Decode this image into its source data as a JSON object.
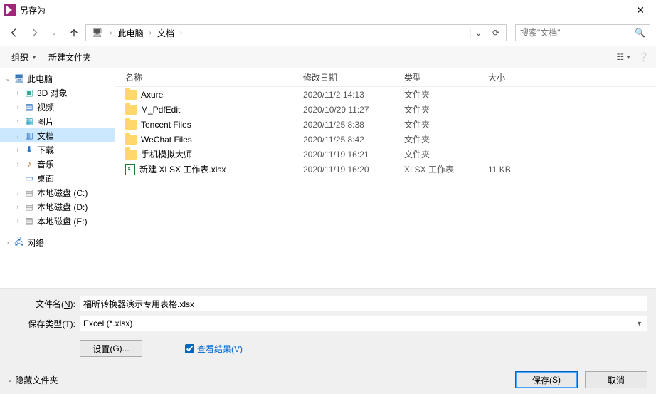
{
  "window": {
    "title": "另存为"
  },
  "breadcrumb": {
    "root": "此电脑",
    "folder": "文档"
  },
  "search": {
    "placeholder": "搜索\"文档\""
  },
  "toolbar": {
    "organize": "组织",
    "new_folder": "新建文件夹"
  },
  "columns": {
    "name": "名称",
    "date": "修改日期",
    "type": "类型",
    "size": "大小"
  },
  "tree": {
    "this_pc": "此电脑",
    "items": [
      {
        "label": "3D 对象"
      },
      {
        "label": "视频"
      },
      {
        "label": "图片"
      },
      {
        "label": "文档"
      },
      {
        "label": "下载"
      },
      {
        "label": "音乐"
      },
      {
        "label": "桌面"
      },
      {
        "label": "本地磁盘 (C:)"
      },
      {
        "label": "本地磁盘 (D:)"
      },
      {
        "label": "本地磁盘 (E:)"
      }
    ],
    "network": "网络"
  },
  "files": [
    {
      "name": "Axure",
      "date": "2020/11/2 14:13",
      "type": "文件夹",
      "size": "",
      "kind": "folder"
    },
    {
      "name": "M_PdfEdit",
      "date": "2020/10/29 11:27",
      "type": "文件夹",
      "size": "",
      "kind": "folder"
    },
    {
      "name": "Tencent Files",
      "date": "2020/11/25 8:38",
      "type": "文件夹",
      "size": "",
      "kind": "folder"
    },
    {
      "name": "WeChat Files",
      "date": "2020/11/25 8:42",
      "type": "文件夹",
      "size": "",
      "kind": "folder"
    },
    {
      "name": "手机模拟大师",
      "date": "2020/11/19 16:21",
      "type": "文件夹",
      "size": "",
      "kind": "folder"
    },
    {
      "name": "新建 XLSX 工作表.xlsx",
      "date": "2020/11/19 16:20",
      "type": "XLSX 工作表",
      "size": "11 KB",
      "kind": "xlsx"
    }
  ],
  "form": {
    "filename_label_pre": "文件名(",
    "filename_label_key": "N",
    "filename_label_post": "):",
    "filename_value": "福昕转换器演示专用表格.xlsx",
    "filetype_label_pre": "保存类型(",
    "filetype_label_key": "T",
    "filetype_label_post": "):",
    "filetype_value": "Excel (*.xlsx)",
    "settings_pre": "设置(",
    "settings_key": "G",
    "settings_post": ")...",
    "viewresult_pre": "查看结果(",
    "viewresult_key": "V",
    "viewresult_post": ")"
  },
  "footer": {
    "hide_folders": "隐藏文件夹",
    "save_pre": "保存(",
    "save_key": "S",
    "save_post": ")",
    "cancel": "取消"
  }
}
